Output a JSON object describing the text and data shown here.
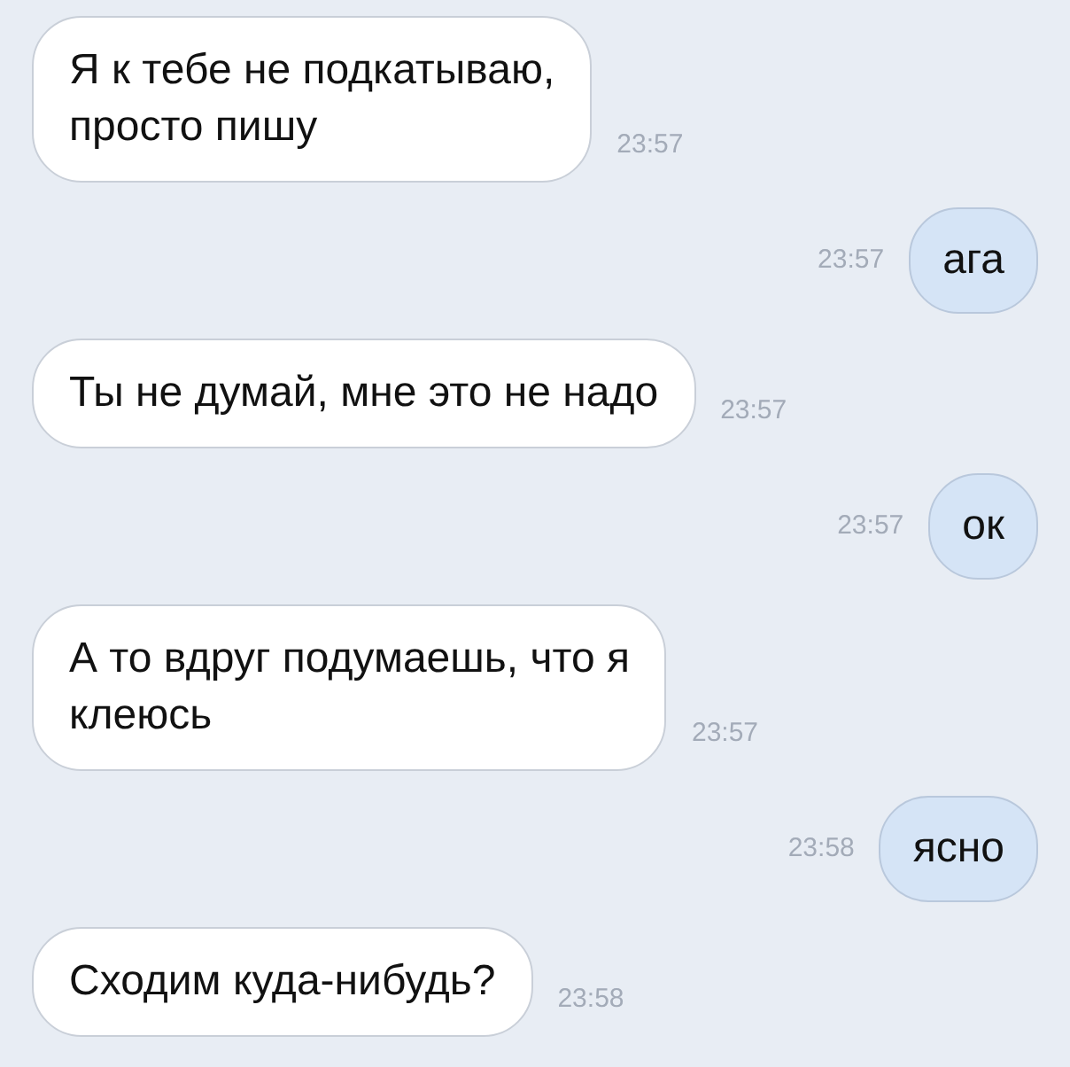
{
  "messages": [
    {
      "kind": "incoming",
      "text": "Я к тебе не подкатываю,\nпросто пишу",
      "time": "23:57"
    },
    {
      "kind": "outgoing",
      "text": "ага",
      "time": "23:57"
    },
    {
      "kind": "incoming",
      "text": "Ты не думай, мне это не надо",
      "time": "23:57"
    },
    {
      "kind": "outgoing",
      "text": "ок",
      "time": "23:57"
    },
    {
      "kind": "incoming",
      "text": "А то вдруг подумаешь, что я\nклеюсь",
      "time": "23:57"
    },
    {
      "kind": "outgoing",
      "text": "ясно",
      "time": "23:58"
    },
    {
      "kind": "incoming",
      "text": "Сходим куда-нибудь?",
      "time": "23:58"
    }
  ]
}
